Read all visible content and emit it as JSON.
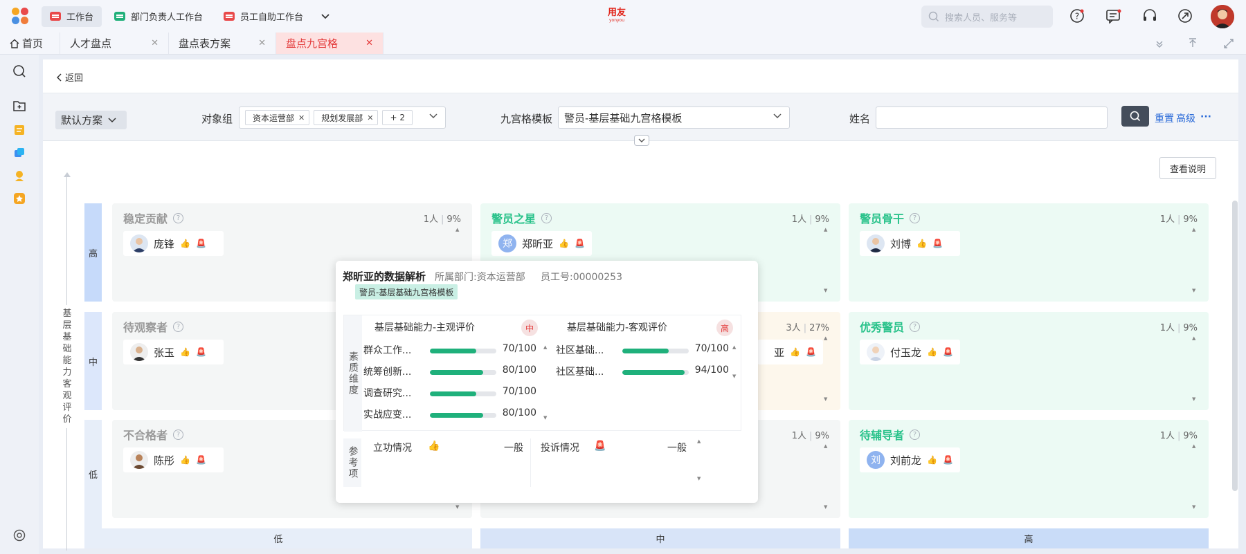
{
  "topbar": {
    "workspaces": [
      {
        "label": "工作台",
        "color": "#e9494a"
      },
      {
        "label": "部门负责人工作台",
        "color": "#20b07a"
      },
      {
        "label": "员工自助工作台",
        "color": "#e9494a"
      }
    ],
    "brand": "用友",
    "brand_sub": "yonyou",
    "search_placeholder": "搜索人员、服务等",
    "icons": [
      "help-icon",
      "message-icon",
      "headset-icon",
      "rocket-icon"
    ]
  },
  "tabs": [
    {
      "label": "首页",
      "icon": "home-icon"
    },
    {
      "label": "人才盘点",
      "closable": true
    },
    {
      "label": "盘点表方案",
      "closable": true
    },
    {
      "label": "盘点九宫格",
      "closable": true,
      "active": true
    }
  ],
  "main": {
    "back_label": "返回",
    "scheme_label": "默认方案",
    "filters": {
      "group_label": "对象组",
      "group_chips": [
        "资本运营部",
        "规划发展部",
        "+ 2"
      ],
      "template_label": "九宫格模板",
      "template_value": "警员-基层基础九宫格模板",
      "name_label": "姓名",
      "name_value": ""
    },
    "reset_label": "重置",
    "advanced_label": "高级",
    "more_label": "···",
    "explain_label": "查看说明",
    "y_axis_title": "基层基础能力客观评价",
    "y_levels": [
      "高",
      "中",
      "低"
    ],
    "x_levels": [
      "低",
      "中",
      "高"
    ]
  },
  "grid": [
    {
      "title": "稳定贡献",
      "count": "1人",
      "pct": "9%",
      "color": "#999999",
      "person": "庞锋"
    },
    {
      "title": "警员之星",
      "count": "1人",
      "pct": "9%",
      "color": "#28c28a",
      "person": "郑昕亚",
      "avatar_text": "郑"
    },
    {
      "title": "警员骨干",
      "count": "1人",
      "pct": "9%",
      "color": "#28c28a",
      "person": "刘博"
    },
    {
      "title": "待观察者",
      "count": "",
      "pct": "",
      "color": "#999999",
      "person": "张玉"
    },
    {
      "title": "",
      "count": "3人",
      "pct": "27%",
      "color": "#999999",
      "person": "亚"
    },
    {
      "title": "优秀警员",
      "count": "1人",
      "pct": "9%",
      "color": "#28c28a",
      "person": "付玉龙"
    },
    {
      "title": "不合格者",
      "count": "",
      "pct": "",
      "color": "#999999",
      "person": "陈彤"
    },
    {
      "title": "",
      "count": "1人",
      "pct": "9%",
      "color": "#999999",
      "person": ""
    },
    {
      "title": "待辅导者",
      "count": "1人",
      "pct": "9%",
      "color": "#28c28a",
      "person": "刘前龙",
      "avatar_text": "刘"
    }
  ],
  "popup": {
    "title": "郑昕亚的数据解析",
    "dept": "所属部门:资本运营部",
    "emp_no": "员工号:00000253",
    "template_tag": "警员-基层基础九宫格模板",
    "quality_label": "素质维度",
    "dimensions": [
      {
        "name": "基层基础能力-主观评价",
        "level": "中",
        "metrics": [
          {
            "name": "群众工作...",
            "score": 70,
            "text": "70/100"
          },
          {
            "name": "统筹创新...",
            "score": 80,
            "text": "80/100"
          },
          {
            "name": "调查研究...",
            "score": 70,
            "text": "70/100"
          },
          {
            "name": "实战应变...",
            "score": 80,
            "text": "80/100"
          }
        ]
      },
      {
        "name": "基层基础能力-客观评价",
        "level": "高",
        "metrics": [
          {
            "name": "社区基础...",
            "score": 70,
            "text": "70/100"
          },
          {
            "name": "社区基础...",
            "score": 94,
            "text": "94/100"
          }
        ]
      }
    ],
    "ref_label": "参考项",
    "refs": [
      {
        "name": "立功情况",
        "icon": "thumb-up-icon",
        "value": "一般"
      },
      {
        "name": "投诉情况",
        "icon": "alarm-icon",
        "value": "一般"
      }
    ]
  }
}
